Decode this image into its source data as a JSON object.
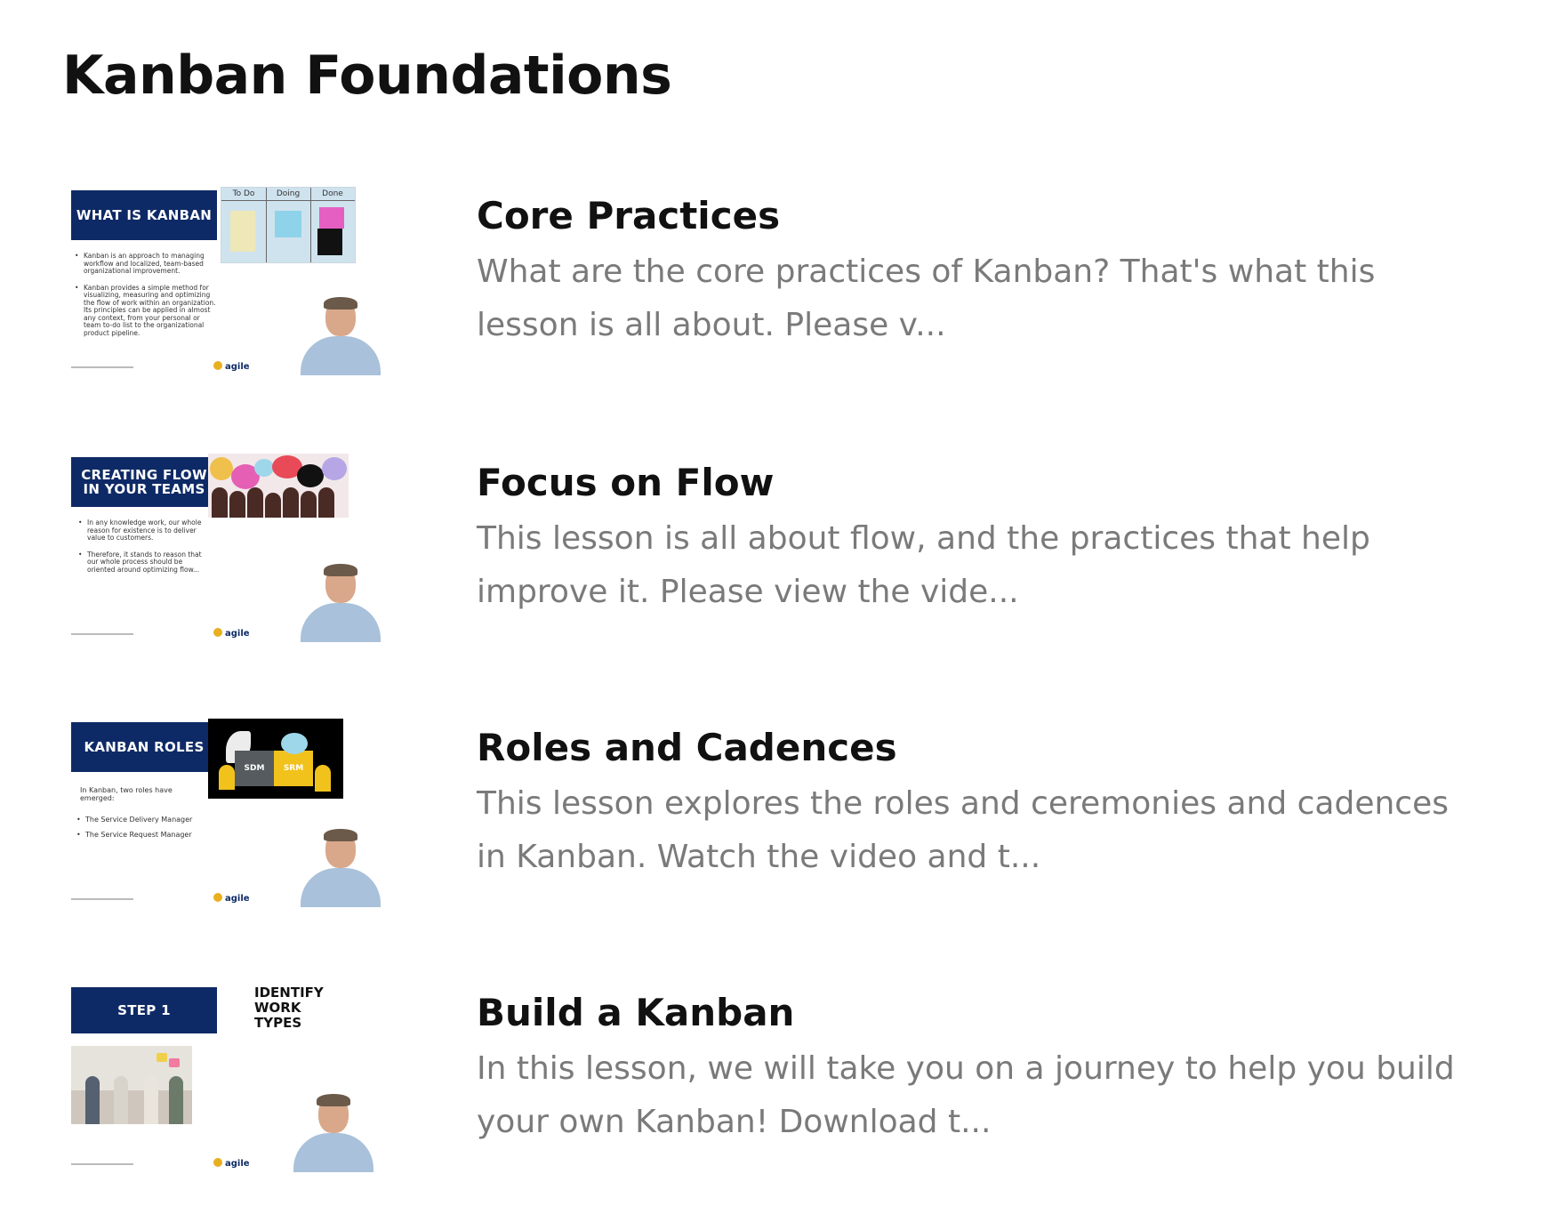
{
  "page": {
    "title": "Kanban Foundations"
  },
  "lessons": [
    {
      "title": "Core Practices",
      "description": "What are the core practices of Kanban?  That's what this\nlesson is all about.  Please v...",
      "thumbnail": {
        "header": "WHAT IS KANBAN",
        "bullets": [
          "Kanban is an approach to managing workflow and localized, team-based organizational improvement.",
          "Kanban provides a simple method for visualizing, measuring and optimizing the flow of work within an organization. Its principles can be applied in almost any context, from your personal or team to-do list to the organizational product pipeline."
        ],
        "board_columns": [
          "To Do",
          "Doing",
          "Done"
        ],
        "logo": "agile"
      }
    },
    {
      "title": "Focus on Flow",
      "description": "This lesson is all about flow, and the practices that help\nimprove it.  Please view the vide...",
      "thumbnail": {
        "header": "CREATING FLOW IN YOUR TEAMS",
        "bullets": [
          "In any knowledge work, our whole reason for existence is to deliver value to customers.",
          "Therefore, it stands to reason that our whole process should be oriented around optimizing flow..."
        ],
        "logo": "agile"
      }
    },
    {
      "title": "Roles and Cadences",
      "description": "This lesson explores the roles and ceremonies and cadences\nin Kanban.  Watch the video and t...",
      "thumbnail": {
        "header": "KANBAN ROLES",
        "intro": "In Kanban, two roles have emerged:",
        "bullets": [
          "The Service Delivery Manager",
          "The Service Request Manager"
        ],
        "puzzle_labels": [
          "SDM",
          "SRM"
        ],
        "logo": "agile"
      }
    },
    {
      "title": "Build a Kanban",
      "description": "In this lesson, we will take you on a journey to help you build\nyour own Kanban!  Download t...",
      "thumbnail": {
        "header": "STEP 1",
        "side_title": "IDENTIFY WORK TYPES",
        "logo": "agile"
      }
    }
  ],
  "colors": {
    "slide_header_bg": "#0e2a66",
    "title_text": "#111111",
    "description_text": "#7a7a7a"
  }
}
